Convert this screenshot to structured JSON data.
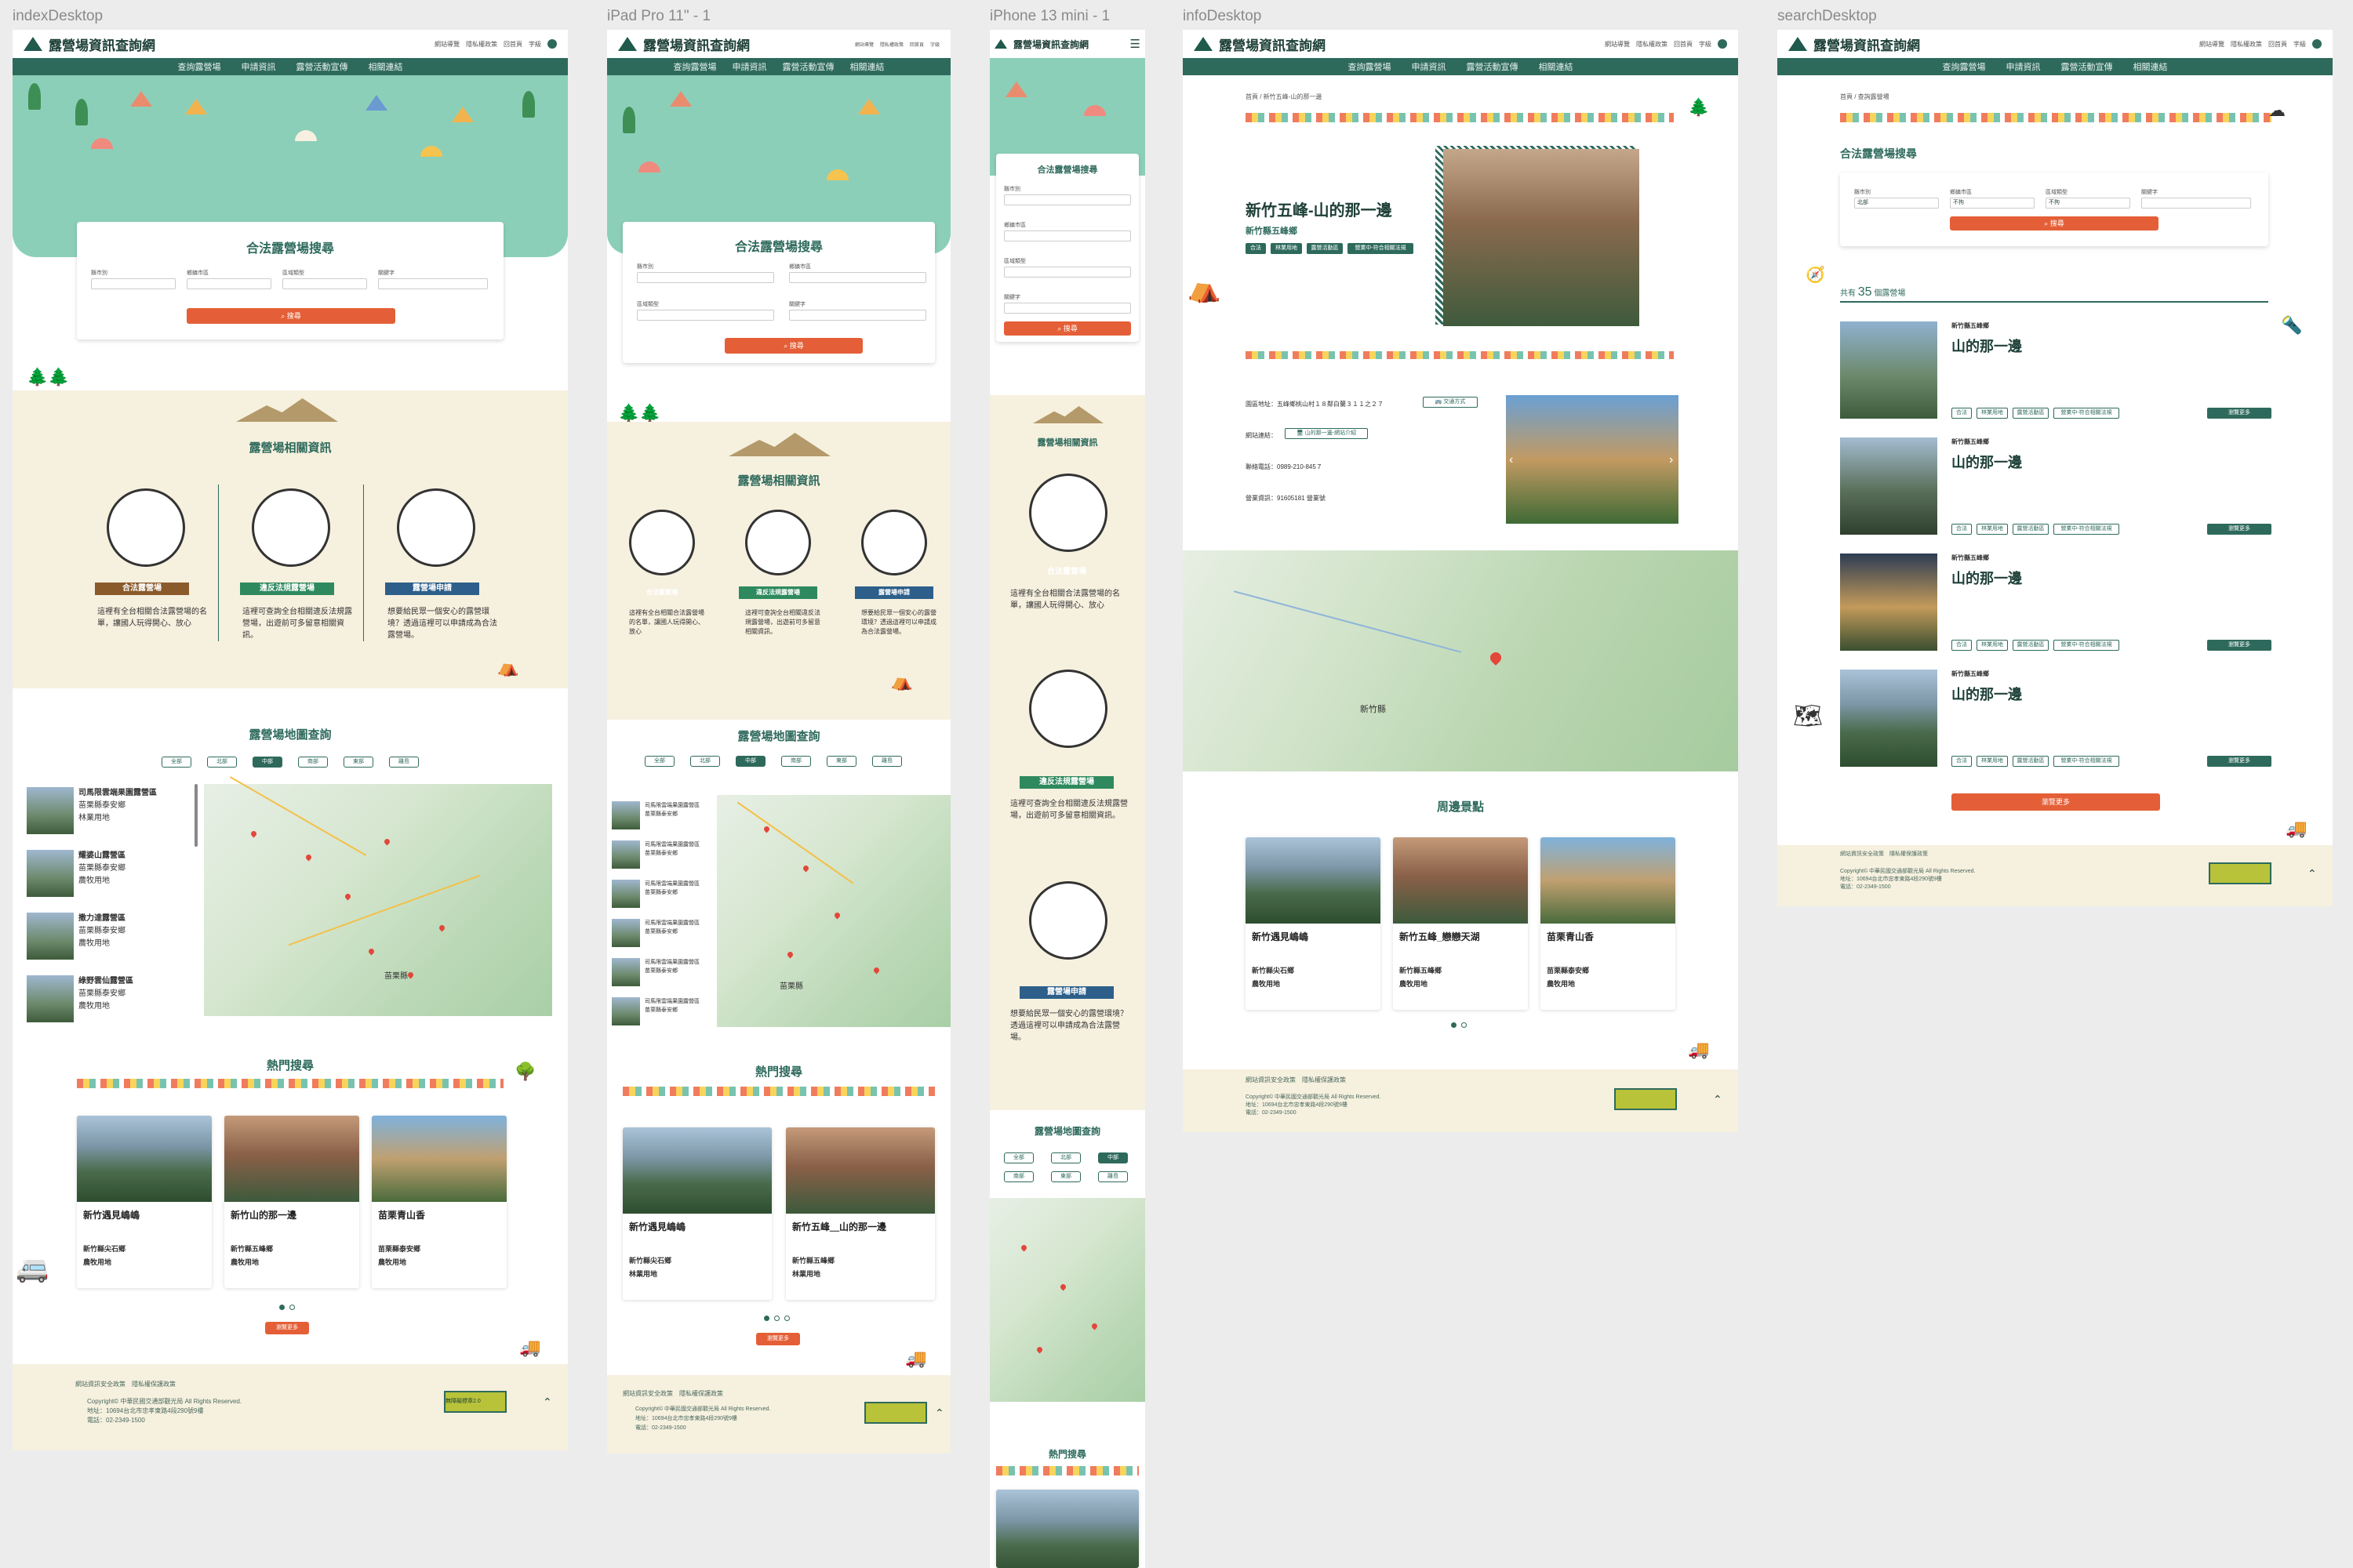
{
  "frames": {
    "index": {
      "label": "indexDesktop"
    },
    "ipad": {
      "label": "iPad Pro 11\" - 1"
    },
    "iphone": {
      "label": "iPhone 13 mini - 1"
    },
    "info": {
      "label": "infoDesktop"
    },
    "search": {
      "label": "searchDesktop"
    }
  },
  "site": {
    "title": "露營場資訊查詢網",
    "nav": [
      "查詢露營場",
      "申請資訊",
      "露營活動宣傳",
      "相關連結"
    ],
    "utils": [
      "網站導覽",
      "隱私權政策",
      "回首頁",
      "字級"
    ]
  },
  "search_panel": {
    "title": "合法露營場搜尋",
    "fields": [
      "縣市別",
      "鄉鎮市區",
      "區域類型",
      "關鍵字"
    ],
    "button": "搜尋"
  },
  "info_section": {
    "title": "露營場相關資訊",
    "items": [
      {
        "label": "合法露營場",
        "desc": "這裡有全台相關合法露營場的名單，讓國人玩得開心、放心",
        "color": "#8a5a2b"
      },
      {
        "label": "違反法規露營場",
        "desc": "這裡可查詢全台相關違反法規露營場，出遊前可多留意相關資訊。",
        "color": "#2e8a5e"
      },
      {
        "label": "露營場申請",
        "desc": "想要給民眾一個安心的露營環境？透過這裡可以申請成為合法露營場。",
        "color": "#2d5f8a"
      }
    ]
  },
  "map_section": {
    "title": "露營場地圖查詢",
    "regions": [
      "全部",
      "北部",
      "中部",
      "南部",
      "東部",
      "離島"
    ],
    "active_region": "中部",
    "map_label": "苗栗縣",
    "list": [
      {
        "name": "司馬限雲端果園露營區",
        "area": "苗栗縣泰安鄉",
        "type": "林業用地"
      },
      {
        "name": "耀婆山露營區",
        "area": "苗栗縣泰安鄉",
        "type": "農牧用地"
      },
      {
        "name": "撒力達露營區",
        "area": "苗栗縣泰安鄉",
        "type": "農牧用地"
      },
      {
        "name": "綠野雲仙露營區",
        "area": "苗栗縣泰安鄉",
        "type": "農牧用地"
      }
    ]
  },
  "hot_section": {
    "title": "熱門搜尋",
    "cards": [
      {
        "name": "新竹遇見嶋嶋",
        "area": "新竹縣尖石鄉",
        "type": "農牧用地"
      },
      {
        "name": "新竹山的那一邊",
        "area": "新竹縣五峰鄉",
        "type": "農牧用地"
      },
      {
        "name": "苗栗青山香",
        "area": "苗栗縣泰安鄉",
        "type": "農牧用地"
      }
    ],
    "more": "瀏覽更多"
  },
  "footer": {
    "links": [
      "網站資訊安全政策",
      "隱私權保護政策"
    ],
    "copyright": "Copyright© 中華民國交通部觀光局 All Rights Reserved.",
    "address": "地址：10694台北市忠孝東路4段290號9樓",
    "phone": "電話：02-2349-1500",
    "logo_text": "無障礙標章2.0"
  },
  "info_page": {
    "breadcrumb": "首頁 / 新竹五峰-山的那一邊",
    "name": "新竹五峰-山的那一邊",
    "area": "新竹縣五峰鄉",
    "tags": [
      "合法",
      "林業用地",
      "露營活動區",
      "營業中-符合相關法規"
    ],
    "address": "園區地址：五峰鄉桃山村１８鄰白蘭３１１之２７",
    "nav_btn": "交通方式",
    "website_label": "網站連結：",
    "website_btn": "山的那一邊-網站介紹",
    "phone": "聯絡電話：0989-210-845７",
    "license": "營業資訊：91605181 營業號",
    "map_label": "新竹縣",
    "nearby_title": "周邊景點",
    "nearby": [
      {
        "name": "新竹遇見嶋嶋",
        "area": "新竹縣尖石鄉",
        "type": "農牧用地"
      },
      {
        "name": "新竹五峰_戀戀天湖",
        "area": "新竹縣五峰鄉",
        "type": "農牧用地"
      },
      {
        "name": "苗栗青山香",
        "area": "苗栗縣泰安鄉",
        "type": "農牧用地"
      }
    ]
  },
  "search_page": {
    "breadcrumb": "首頁 / 查詢露營場",
    "count_prefix": "共有",
    "count": "35",
    "count_suffix": "個露營場",
    "results": [
      {
        "area": "新竹縣五峰鄉",
        "name": "山的那一邊"
      },
      {
        "area": "新竹縣五峰鄉",
        "name": "山的那一邊"
      },
      {
        "area": "新竹縣五峰鄉",
        "name": "山的那一邊"
      },
      {
        "area": "新竹縣五峰鄉",
        "name": "山的那一邊"
      }
    ],
    "tags": [
      "合法",
      "林業用地",
      "露營活動區",
      "營業中-符合相關法規"
    ],
    "detail_btn": "瀏覽更多",
    "more": "瀏覽更多",
    "sel_values": [
      "北部",
      "不拘",
      "不拘"
    ]
  },
  "colors": {
    "primary": "#2e6a5c",
    "accent": "#e45f37",
    "beige": "#f6f0df",
    "hero": "#8ccfb9"
  }
}
